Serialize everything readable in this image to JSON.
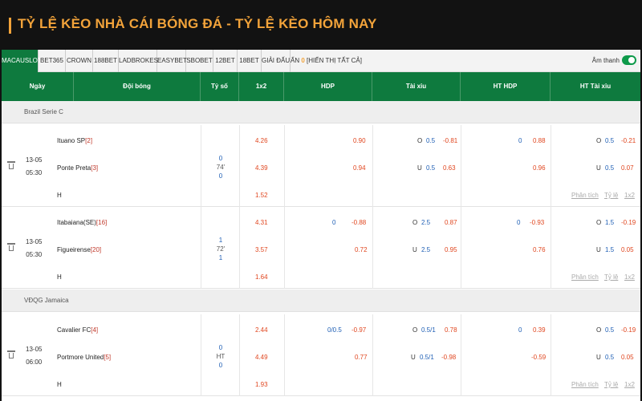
{
  "page": {
    "title": "TỶ LỆ KÈO NHÀ CÁI BÓNG ĐÁ - TỶ LỆ KÈO HÔM NAY"
  },
  "tabs": [
    "MACAUSLOT",
    "BET365",
    "CROWN",
    "188BET",
    "LADBROKES",
    "EASYBET",
    "SBOBET",
    "12BET",
    "18BET",
    "GIẢI ĐẤU"
  ],
  "hide": {
    "label": "ẨN",
    "count": "0",
    "show_all": "[HIỂN THỊ TẤT CẢ]"
  },
  "sound": {
    "label": "Âm thanh",
    "on": true
  },
  "columns": [
    "Ngày",
    "Đội bóng",
    "Tỷ số",
    "1x2",
    "HDP",
    "Tài xỉu",
    "HT HDP",
    "HT Tài xỉu"
  ],
  "actions": {
    "analysis": "Phân tích",
    "odds": "Tỷ lệ",
    "onextwo": "1x2"
  },
  "colors": {
    "accent": "#f2a33a",
    "header_green": "#0e7a3e",
    "odds_red": "#e0461f",
    "line_blue": "#1f5fb5"
  },
  "leagues": [
    {
      "name": "Brazil Serie C",
      "matches": [
        {
          "date": "13-05",
          "time": "05:30",
          "home": "Ituano SP",
          "home_rank": "[2]",
          "away": "Ponte Preta",
          "away_rank": "[3]",
          "score_home": "0",
          "score_mid": "74'",
          "score_away": "0",
          "x12": [
            "4.26",
            "4.39",
            "1.52"
          ],
          "hdp_line": "",
          "hdp_odds": [
            "0.90",
            "0.94"
          ],
          "ou_tag": [
            "O",
            "U"
          ],
          "ou_line": [
            "0.5",
            "0.5"
          ],
          "ou_odds": [
            "-0.81",
            "0.63"
          ],
          "ht_hdp_line": "0",
          "ht_hdp_odds": [
            "0.88",
            "0.96"
          ],
          "ht_ou_tag": [
            "O",
            "U"
          ],
          "ht_ou_line": [
            "0.5",
            "0.5"
          ],
          "ht_ou_odds": [
            "-0.21",
            "0.07"
          ]
        },
        {
          "date": "13-05",
          "time": "05:30",
          "home": "Itabaiana(SE)",
          "home_rank": "[16]",
          "away": "Figueirense",
          "away_rank": "[20]",
          "score_home": "1",
          "score_mid": "72'",
          "score_away": "1",
          "x12": [
            "4.31",
            "3.57",
            "1.64"
          ],
          "hdp_line": "0",
          "hdp_odds": [
            "-0.88",
            "0.72"
          ],
          "ou_tag": [
            "O",
            "U"
          ],
          "ou_line": [
            "2.5",
            "2.5"
          ],
          "ou_odds": [
            "0.87",
            "0.95"
          ],
          "ht_hdp_line": "0",
          "ht_hdp_odds": [
            "-0.93",
            "0.76"
          ],
          "ht_ou_tag": [
            "O",
            "U"
          ],
          "ht_ou_line": [
            "1.5",
            "1.5"
          ],
          "ht_ou_odds": [
            "-0.19",
            "0.05"
          ]
        }
      ]
    },
    {
      "name": "VĐQG Jamaica",
      "matches": [
        {
          "date": "13-05",
          "time": "06:00",
          "home": "Cavalier FC",
          "home_rank": "[4]",
          "away": "Portmore United",
          "away_rank": "[5]",
          "score_home": "0",
          "score_mid": "HT",
          "score_away": "0",
          "x12": [
            "2.44",
            "4.49",
            "1.93"
          ],
          "hdp_line": "0/0.5",
          "hdp_odds": [
            "-0.97",
            "0.77"
          ],
          "ou_tag": [
            "O",
            "U"
          ],
          "ou_line": [
            "0.5/1",
            "0.5/1"
          ],
          "ou_odds": [
            "0.78",
            "-0.98"
          ],
          "ht_hdp_line": "0",
          "ht_hdp_odds": [
            "0.39",
            "-0.59"
          ],
          "ht_ou_tag": [
            "O",
            "U"
          ],
          "ht_ou_line": [
            "0.5",
            "0.5"
          ],
          "ht_ou_odds": [
            "-0.19",
            "0.05"
          ]
        }
      ]
    }
  ]
}
